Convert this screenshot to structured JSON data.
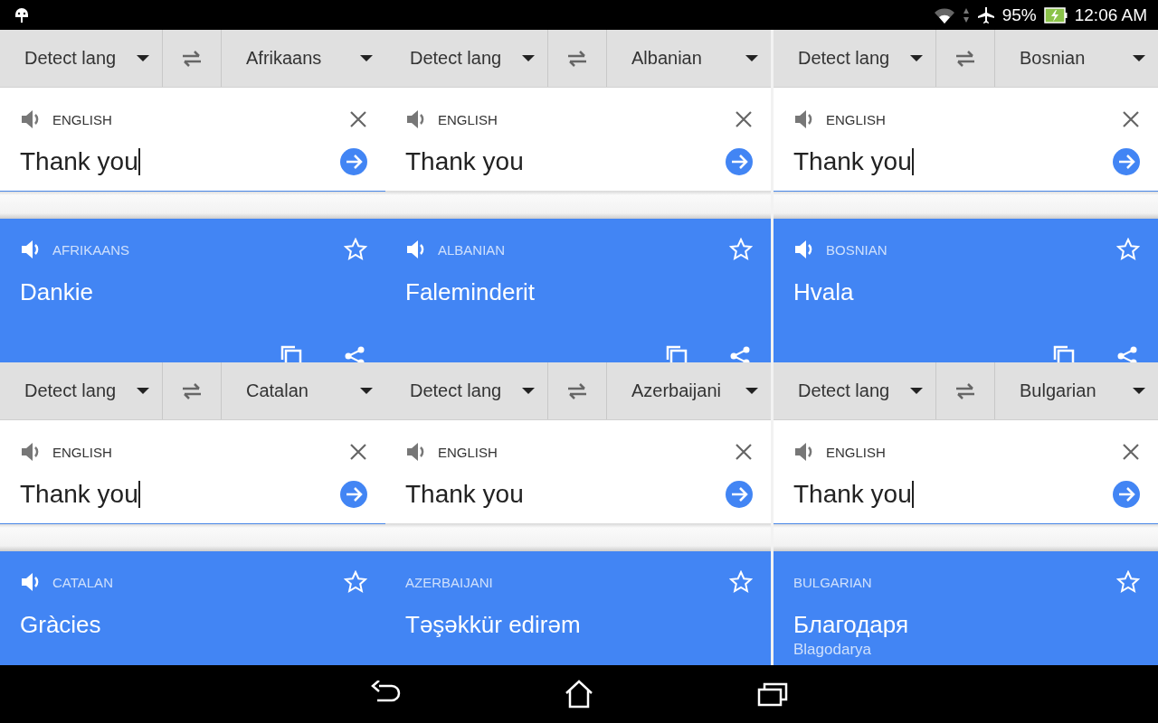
{
  "status_bar": {
    "battery": "95%",
    "time": "12:06 AM"
  },
  "panels": [
    {
      "source_lang": "Detect lang",
      "target_lang": "Afrikaans",
      "input_label": "ENGLISH",
      "input_text": "Thank you",
      "focused": true,
      "result": {
        "label": "AFRIKAANS",
        "text": "Dankie",
        "speaker": true,
        "actions": true
      }
    },
    {
      "source_lang": "Detect lang",
      "target_lang": "Albanian",
      "input_label": "ENGLISH",
      "input_text": "Thank you",
      "focused": false,
      "result": {
        "label": "ALBANIAN",
        "text": "Faleminderit",
        "speaker": true,
        "actions": true
      }
    },
    {
      "source_lang": "Detect lang",
      "target_lang": "Bosnian",
      "input_label": "ENGLISH",
      "input_text": "Thank you",
      "focused": true,
      "result": {
        "label": "BOSNIAN",
        "text": "Hvala",
        "speaker": true,
        "actions": true
      }
    },
    {
      "source_lang": "Detect lang",
      "target_lang": "Catalan",
      "input_label": "ENGLISH",
      "input_text": "Thank you",
      "focused": true,
      "result": {
        "label": "CATALAN",
        "text": "Gràcies",
        "speaker": true
      }
    },
    {
      "source_lang": "Detect lang",
      "target_lang": "Azerbaijani",
      "input_label": "ENGLISH",
      "input_text": "Thank you",
      "focused": false,
      "result": {
        "label": "AZERBAIJANI",
        "text": "Təşəkkür edirəm",
        "speaker": false
      }
    },
    {
      "source_lang": "Detect lang",
      "target_lang": "Bulgarian",
      "input_label": "ENGLISH",
      "input_text": "Thank you",
      "focused": true,
      "result": {
        "label": "BULGARIAN",
        "text": "Благодаря",
        "romanization": "Blagodarya",
        "speaker": false
      }
    }
  ]
}
